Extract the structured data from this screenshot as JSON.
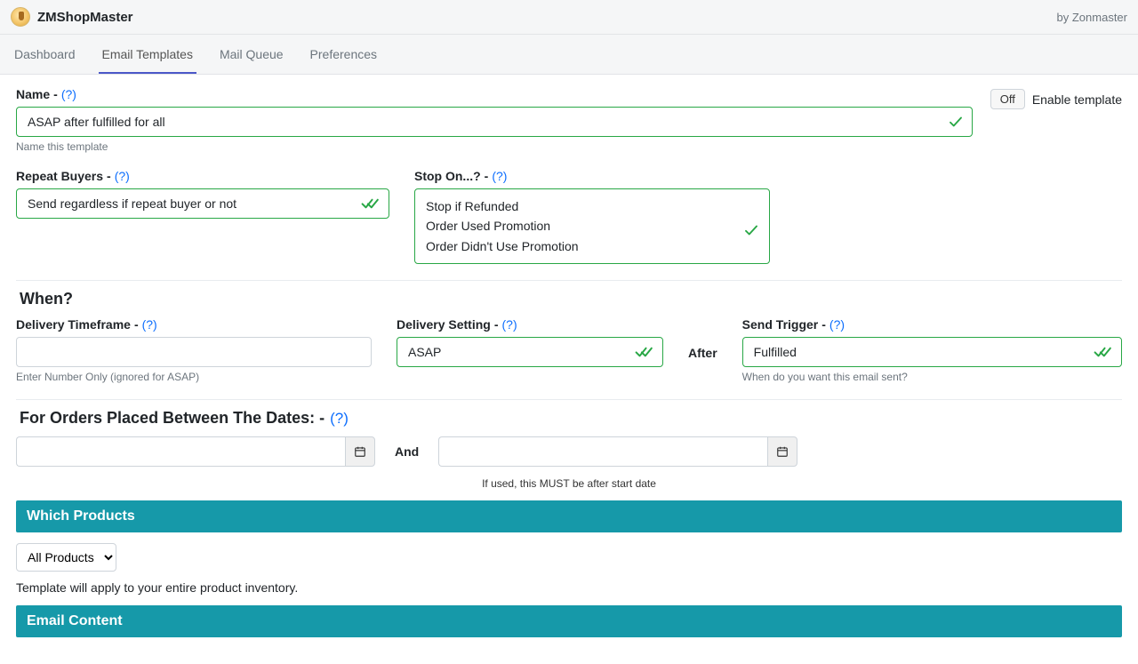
{
  "header": {
    "app_name": "ZMShopMaster",
    "byline": "by Zonmaster"
  },
  "nav": {
    "tabs": [
      "Dashboard",
      "Email Templates",
      "Mail Queue",
      "Preferences"
    ],
    "active_index": 1
  },
  "toggle": {
    "off_label": "Off",
    "enable_label": "Enable template"
  },
  "name": {
    "label": "Name",
    "help": "(?)",
    "value": "ASAP after fulfilled for all",
    "hint": "Name this template"
  },
  "repeat_buyers": {
    "label": "Repeat Buyers",
    "help": "(?)",
    "value": "Send regardless if repeat buyer or not"
  },
  "stop_on": {
    "label": "Stop On...?",
    "help": "(?)",
    "lines": [
      "Stop if Refunded",
      "Order Used Promotion",
      "Order Didn't Use Promotion"
    ]
  },
  "when": {
    "heading": "When?",
    "timeframe": {
      "label": "Delivery Timeframe",
      "help": "(?)",
      "value": "",
      "hint": "Enter Number Only (ignored for ASAP)"
    },
    "setting": {
      "label": "Delivery Setting",
      "help": "(?)",
      "value": "ASAP"
    },
    "after_label": "After",
    "trigger": {
      "label": "Send Trigger",
      "help": "(?)",
      "value": "Fulfilled",
      "hint": "When do you want this email sent?"
    }
  },
  "dates": {
    "heading": "For Orders Placed Between The Dates: -",
    "help": "(?)",
    "start": "",
    "end": "",
    "and_label": "And",
    "note": "If used, this MUST be after start date"
  },
  "products": {
    "bar": "Which Products",
    "select_value": "All Products",
    "note": "Template will apply to your entire product inventory."
  },
  "email_content": {
    "bar": "Email Content"
  }
}
